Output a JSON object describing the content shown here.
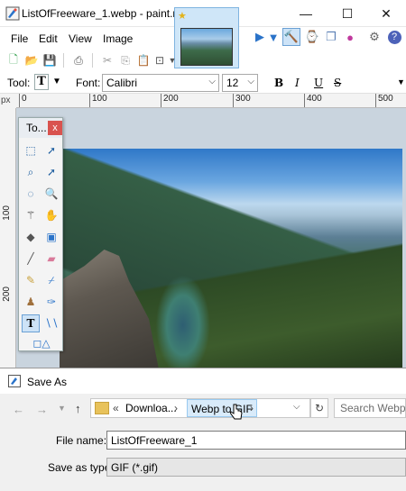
{
  "window": {
    "title": "ListOfFreeware_1.webp - paint.net 4.0.17",
    "minimize": "—",
    "maximize": "☐",
    "close": "✕"
  },
  "menu": [
    "File",
    "Edit",
    "View",
    "Image"
  ],
  "textbar": {
    "tool_label": "Tool:",
    "font_label": "Font:",
    "font_value": "Calibri",
    "size_value": "12",
    "bold": "B",
    "italic": "I",
    "underline": "U",
    "strike": "S"
  },
  "ruler": {
    "corner": "px",
    "h_ticks": [
      "0",
      "100",
      "200",
      "300",
      "400",
      "500"
    ],
    "v_ticks": [
      "100",
      "200"
    ]
  },
  "tools_window": {
    "title": "To...",
    "close": "x"
  },
  "dialog": {
    "title": "Save As",
    "breadcrumb": {
      "prefix": "«",
      "downloads": "Downloa...",
      "folder": "Webp to GIF"
    },
    "search_placeholder": "Search Webp t",
    "file_name_label": "File name:",
    "file_name_value": "ListOfFreeware_1",
    "save_type_label": "Save as type:",
    "save_type_value": "GIF (*.gif)"
  },
  "colors": {
    "selection": "#cde3f7",
    "accent": "#1f5fa0",
    "tab_bg": "#cfe6f8"
  }
}
